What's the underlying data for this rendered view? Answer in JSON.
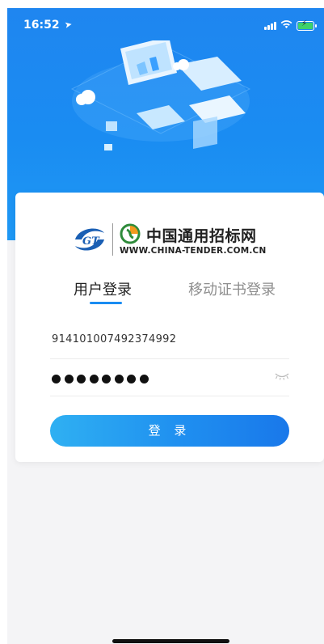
{
  "status_bar": {
    "time": "16:52"
  },
  "logo": {
    "brand_name": "中国通用招标网",
    "url": "WWW.CHINA-TENDER.COM.CN"
  },
  "tabs": [
    {
      "label": "用户登录",
      "active": true
    },
    {
      "label": "移动证书登录",
      "active": false
    }
  ],
  "form": {
    "username_value": "914101007492374992",
    "password_masked_length": 8
  },
  "login_button_label": "登 录",
  "colors": {
    "primary": "#1a8cf2",
    "header_bg": "#1e88f0",
    "page_bg": "#f4f4f6"
  },
  "icons": [
    "location-arrow-icon",
    "signal-icon",
    "wifi-icon",
    "battery-charging-icon",
    "eye-closed-icon"
  ]
}
